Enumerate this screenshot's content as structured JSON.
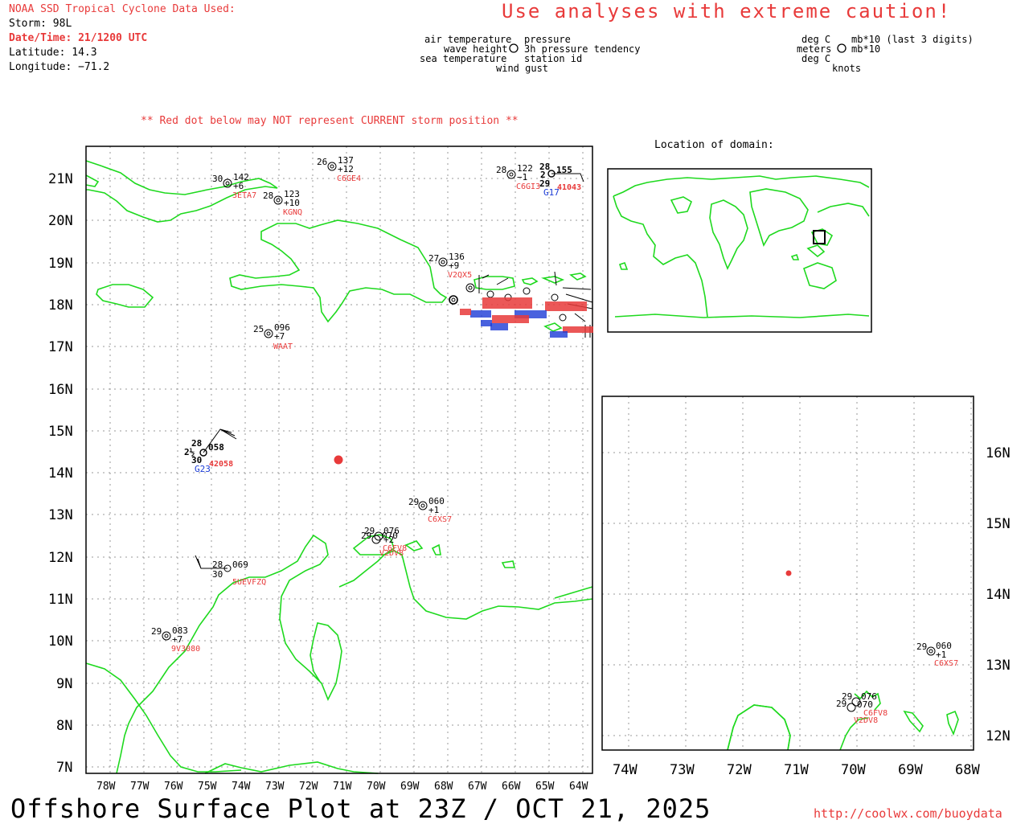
{
  "header": {
    "source": "NOAA SSD Tropical Cyclone Data Used:",
    "storm": "Storm: 98L",
    "datetime": "Date/Time: 21/1200 UTC",
    "latitude": "Latitude: 14.3",
    "longitude": "Longitude: −71.2",
    "caution": "Use analyses with extreme caution!",
    "red_dot_note": "** Red dot below may NOT represent CURRENT storm position **"
  },
  "legend": {
    "left_col": [
      "air temperature",
      "wave height",
      "sea temperature"
    ],
    "right_col": [
      "pressure",
      "3h pressure tendency",
      "station id"
    ],
    "bottom": "wind gust",
    "units_left": [
      "deg C",
      "meters",
      "deg C"
    ],
    "units_right": [
      "mb*10 (last 3 digits)",
      "mb*10"
    ],
    "units_bottom": "knots"
  },
  "inset": {
    "title": "Location of domain:"
  },
  "main_map": {
    "lat_ticks": [
      "21N",
      "20N",
      "19N",
      "18N",
      "17N",
      "16N",
      "15N",
      "14N",
      "13N",
      "12N",
      "11N",
      "10N",
      "9N",
      "8N",
      "7N"
    ],
    "lon_ticks": [
      "78W",
      "77W",
      "76W",
      "75W",
      "74W",
      "73W",
      "72W",
      "71W",
      "70W",
      "69W",
      "68W",
      "67W",
      "66W",
      "65W",
      "64W"
    ],
    "storm_position": {
      "lat": 14.3,
      "lon": -71.2
    },
    "stations": [
      {
        "id": "3ETA7",
        "air": "30",
        "pres": "142",
        "tend": "+6"
      },
      {
        "id": "KGNQ",
        "air": "28",
        "pres": "123",
        "tend": "+10"
      },
      {
        "id": "C6GE4",
        "air": "26",
        "pres": "137",
        "tend": "+12"
      },
      {
        "id": "C6GI3",
        "air": "28",
        "pres": "122",
        "tend": "−1"
      },
      {
        "id": "41043",
        "air": "28",
        "wave": "2",
        "pres": "155",
        "sea": "29"
      },
      {
        "id": "G17",
        "air": "",
        "pres": "",
        "tend": ""
      },
      {
        "id": "V2QX5",
        "air": "27",
        "pres": "136",
        "tend": "+9"
      },
      {
        "id": "WAAT",
        "air": "25",
        "pres": "096",
        "tend": "+7"
      },
      {
        "id": "42058",
        "air": "28",
        "wave": "2½",
        "pres": "058",
        "sea": "30"
      },
      {
        "id": "G23",
        "air": "",
        "pres": "",
        "tend": ""
      },
      {
        "id": "C6XS7",
        "air": "29",
        "pres": "060",
        "tend": "+1"
      },
      {
        "id": "C6FV8",
        "air": "29",
        "pres": "076",
        "tend": "+2"
      },
      {
        "id": "V2DV8",
        "air": "29",
        "pres": "070",
        "tend": ""
      },
      {
        "id": "5UEVFZQ",
        "air": "28",
        "pres": "069",
        "sea": "30"
      },
      {
        "id": "9V3080",
        "air": "29",
        "pres": "083",
        "tend": "+7"
      }
    ]
  },
  "zoom_map": {
    "lat_ticks": [
      "16N",
      "15N",
      "14N",
      "13N",
      "12N"
    ],
    "lon_ticks": [
      "74W",
      "73W",
      "72W",
      "71W",
      "70W",
      "69W",
      "68W"
    ]
  },
  "footer": {
    "title": "Offshore Surface Plot at 23Z / OCT 21, 2025",
    "url": "http://coolwx.com/buoydata"
  },
  "colors": {
    "coast": "#1ed91e",
    "accent": "#e83a3a",
    "station_blue": "#1b3bd6"
  }
}
